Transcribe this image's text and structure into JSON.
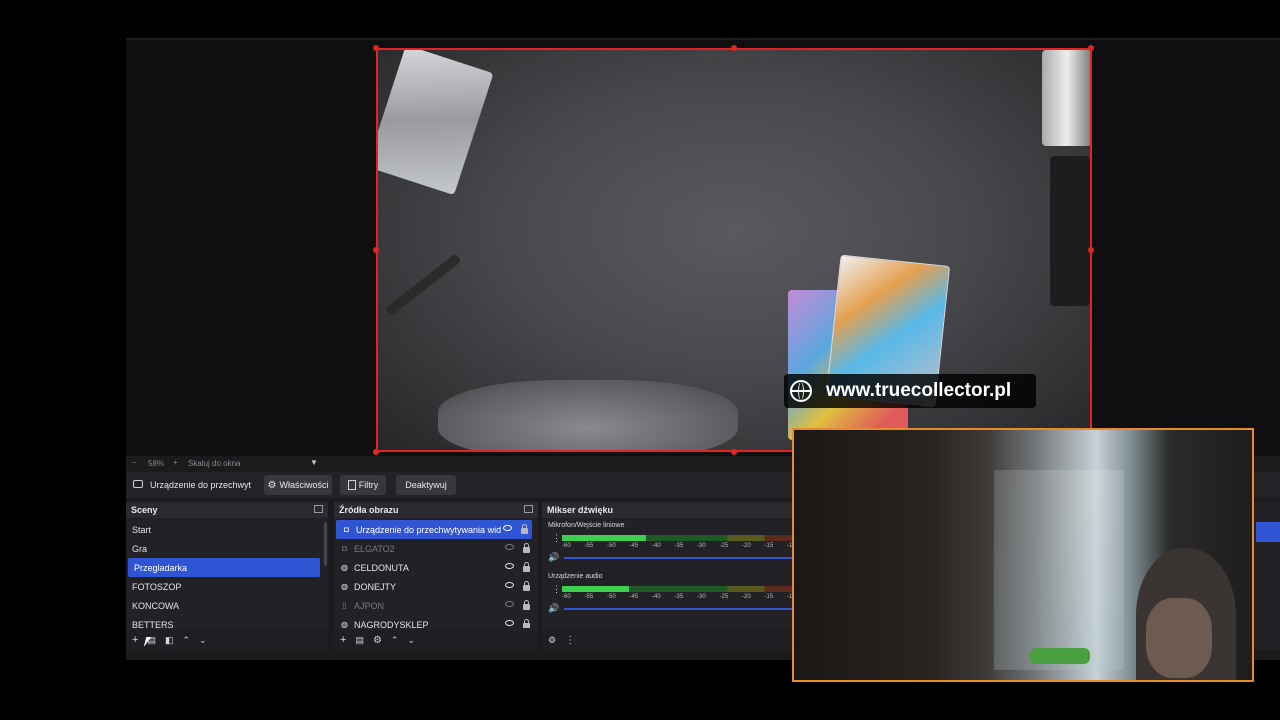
{
  "zoom_bar": {
    "zoom": "58%",
    "scale_label": "Skaluj do okna"
  },
  "source_toolbar": {
    "source_name": "Urządzenie do przechwyt",
    "properties": "Właściwości",
    "filters": "Filtry",
    "deactivate": "Deaktywuj"
  },
  "scenes": {
    "title": "Sceny",
    "items": [
      {
        "label": "Start"
      },
      {
        "label": "Gra"
      },
      {
        "label": "Przegladarka"
      },
      {
        "label": "FOTOSZOP"
      },
      {
        "label": "KONCOWA"
      },
      {
        "label": "BETTERS"
      }
    ],
    "selected": "Przegladarka"
  },
  "sources": {
    "title": "Źródła obrazu",
    "items": [
      {
        "label": "Urządzenie do przechwytywania wid",
        "icon": "camera-icon",
        "visible": true
      },
      {
        "label": "ELGATO2",
        "icon": "camera-icon",
        "visible": false
      },
      {
        "label": "CELDONUTA",
        "icon": "browser-icon",
        "visible": true
      },
      {
        "label": "DONEJTY",
        "icon": "browser-icon",
        "visible": true
      },
      {
        "label": "AJPON",
        "icon": "file-icon",
        "visible": false
      },
      {
        "label": "NAGRODYSKLEP",
        "icon": "browser-icon",
        "visible": true
      }
    ]
  },
  "mixer": {
    "title": "Mikser dźwięku",
    "channels": [
      {
        "name": "Mikrofon/Wejście liniowe",
        "level_db": -40
      },
      {
        "name": "Urządzenie audio",
        "level_db": -44
      }
    ],
    "ticks": [
      "-60",
      "-55",
      "-50",
      "-45",
      "-40",
      "-35",
      "-30",
      "-25",
      "-20",
      "-15",
      "-10"
    ]
  },
  "overlay": {
    "url": "www.truecollector.pl"
  },
  "colors": {
    "accent": "#2f55d4",
    "selection_border": "#e02424",
    "webcam_border": "#e8892a",
    "meter_green": "#3fcf50"
  }
}
